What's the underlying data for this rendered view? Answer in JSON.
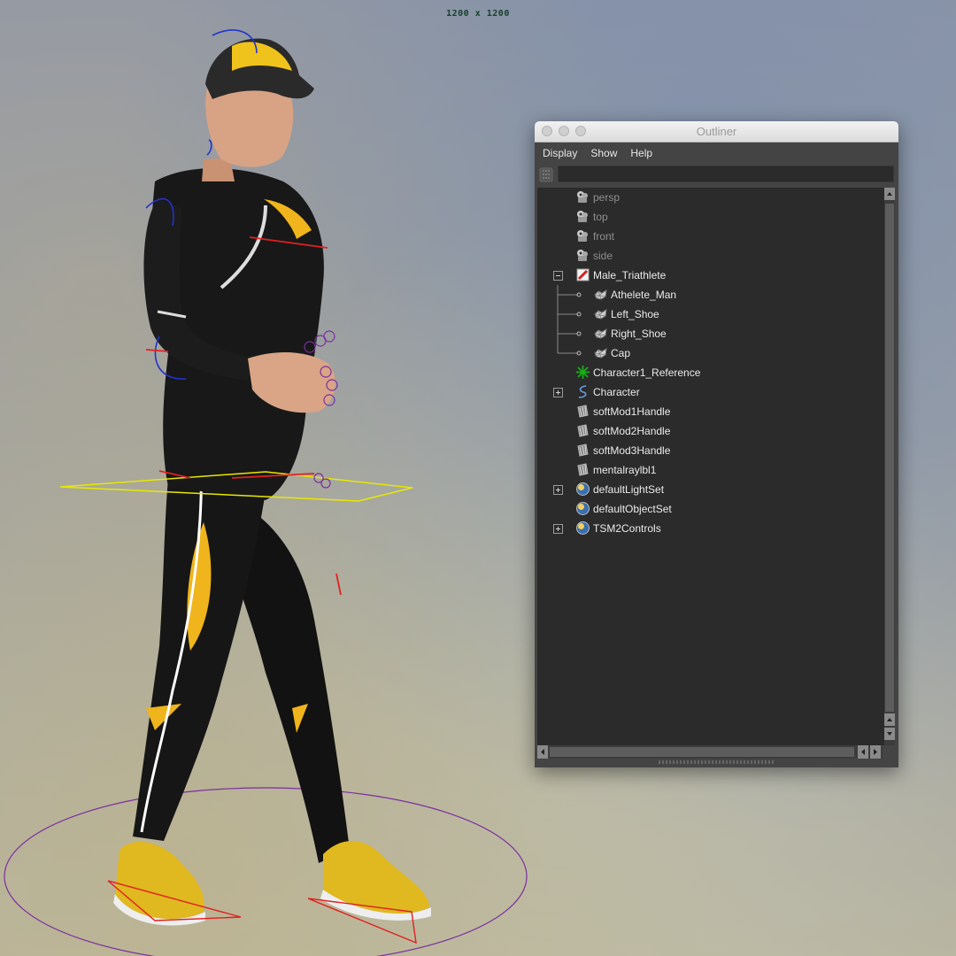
{
  "viewport": {
    "resolution_label": "1200 x 1200"
  },
  "outliner": {
    "title": "Outliner",
    "menu": [
      "Display",
      "Show",
      "Help"
    ],
    "search_value": "",
    "items": [
      {
        "label": "persp",
        "icon": "camera-icon",
        "depth": 0,
        "expander": "none",
        "dim": true
      },
      {
        "label": "top",
        "icon": "camera-icon",
        "depth": 0,
        "expander": "none",
        "dim": true
      },
      {
        "label": "front",
        "icon": "camera-icon",
        "depth": 0,
        "expander": "none",
        "dim": true
      },
      {
        "label": "side",
        "icon": "camera-icon",
        "depth": 0,
        "expander": "none",
        "dim": true
      },
      {
        "label": "Male_Triathlete",
        "icon": "group-icon",
        "depth": 0,
        "expander": "minus",
        "dim": false
      },
      {
        "label": "Athelete_Man",
        "icon": "mesh-icon",
        "depth": 1,
        "expander": "none",
        "dim": false
      },
      {
        "label": "Left_Shoe",
        "icon": "mesh-icon",
        "depth": 1,
        "expander": "none",
        "dim": false
      },
      {
        "label": "Right_Shoe",
        "icon": "mesh-icon",
        "depth": 1,
        "expander": "none",
        "dim": false
      },
      {
        "label": "Cap",
        "icon": "mesh-icon",
        "depth": 1,
        "expander": "none",
        "dim": false,
        "last": true
      },
      {
        "label": "Character1_Reference",
        "icon": "joint-icon",
        "depth": 0,
        "expander": "none",
        "dim": false
      },
      {
        "label": "Character",
        "icon": "curve-icon",
        "depth": 0,
        "expander": "plus",
        "dim": false
      },
      {
        "label": "softMod1Handle",
        "icon": "deformer-icon",
        "depth": 0,
        "expander": "none",
        "dim": false
      },
      {
        "label": "softMod2Handle",
        "icon": "deformer-icon",
        "depth": 0,
        "expander": "none",
        "dim": false
      },
      {
        "label": "softMod3Handle",
        "icon": "deformer-icon",
        "depth": 0,
        "expander": "none",
        "dim": false
      },
      {
        "label": "mentalraylbl1",
        "icon": "deformer-icon",
        "depth": 0,
        "expander": "none",
        "dim": false
      },
      {
        "label": "defaultLightSet",
        "icon": "set-icon",
        "depth": 0,
        "expander": "plus",
        "dim": false
      },
      {
        "label": "defaultObjectSet",
        "icon": "set-icon",
        "depth": 0,
        "expander": "none",
        "dim": false
      },
      {
        "label": "TSM2Controls",
        "icon": "set-icon",
        "depth": 0,
        "expander": "plus",
        "dim": false
      }
    ]
  },
  "colors": {
    "panel_bg": "#444444",
    "tree_bg": "#2b2b2b",
    "suit_yellow": "#f0b51c",
    "rig_blue": "#2233cc",
    "rig_red": "#e02020",
    "rig_yellow": "#e8e800",
    "rig_purple": "#7a2fa0"
  }
}
